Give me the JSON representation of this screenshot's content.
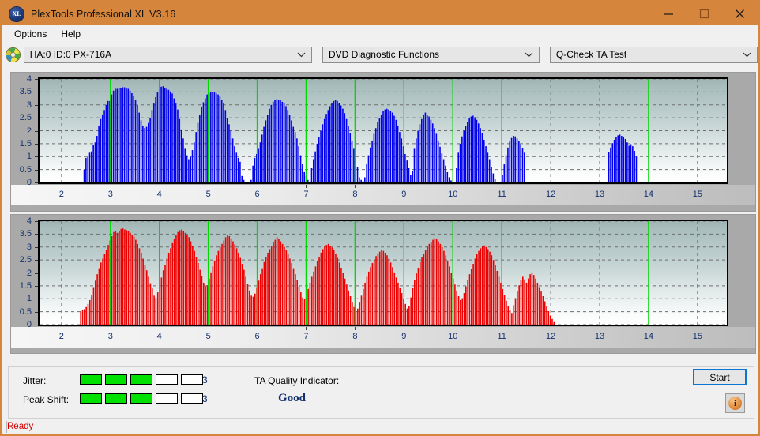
{
  "window": {
    "title": "PlexTools Professional XL V3.16",
    "icon": "XL",
    "minimize_label": "minimize-icon",
    "maximize_label": "maximize-icon",
    "close_label": "close-icon"
  },
  "menu": {
    "items": [
      {
        "label": "Options"
      },
      {
        "label": "Help"
      }
    ]
  },
  "selectors": {
    "drive": {
      "value": "HA:0 ID:0  PX-716A",
      "icon": "disc-icon"
    },
    "function": {
      "value": "DVD Diagnostic Functions"
    },
    "test": {
      "value": "Q-Check TA Test"
    }
  },
  "status": {
    "text": "Ready"
  },
  "results": {
    "jitter_label": "Jitter:",
    "jitter_value": "3",
    "jitter_filled": 3,
    "jitter_total": 5,
    "peak_shift_label": "Peak Shift:",
    "peak_shift_value": "3",
    "peak_shift_filled": 3,
    "peak_shift_total": 5,
    "tqi_label": "TA Quality Indicator:",
    "tqi_value": "Good",
    "start_label": "Start",
    "info_label": "i"
  },
  "colors": {
    "titlebar": "#d6863c",
    "jitter_series": "#0000ee",
    "peak_shift_series": "#ee0000",
    "marker_line": "#00d800",
    "axis_text": "#14306e",
    "status_text": "#d30000",
    "accent_focus": "#0b76d1"
  },
  "chart_data": [
    {
      "type": "bar",
      "title": "Jitter vs. Radius",
      "series_name": "Jitter",
      "color": "#0000ee",
      "xlabel": "",
      "ylabel": "",
      "xlim": [
        1.55,
        15.6
      ],
      "ylim": [
        0,
        4
      ],
      "xticks": [
        2,
        3,
        4,
        5,
        6,
        7,
        8,
        9,
        10,
        11,
        12,
        13,
        14,
        15
      ],
      "yticks": [
        0,
        0.5,
        1,
        1.5,
        2,
        2.5,
        3,
        3.5,
        4
      ],
      "grid": true,
      "marker_lines": [
        3,
        4,
        5,
        6,
        7,
        8,
        9,
        10,
        11,
        14
      ],
      "x_start": 2.45,
      "x_step": 0.0375,
      "values": [
        0.5,
        0.95,
        1.0,
        1.15,
        1.2,
        1.45,
        1.55,
        1.8,
        2.2,
        2.45,
        2.6,
        2.8,
        3.0,
        3.15,
        3.15,
        3.4,
        3.55,
        3.62,
        3.62,
        3.65,
        3.65,
        3.68,
        3.68,
        3.65,
        3.62,
        3.55,
        3.45,
        3.35,
        3.18,
        3.0,
        2.7,
        2.4,
        2.2,
        2.1,
        2.15,
        2.3,
        2.5,
        2.8,
        3.05,
        3.3,
        3.48,
        3.6,
        3.7,
        3.72,
        3.65,
        3.62,
        3.58,
        3.52,
        3.44,
        3.25,
        3.05,
        2.82,
        2.45,
        2.05,
        1.7,
        1.3,
        1.05,
        0.9,
        1.0,
        1.25,
        1.55,
        1.95,
        2.3,
        2.6,
        2.9,
        3.1,
        3.25,
        3.4,
        3.45,
        3.48,
        3.5,
        3.48,
        3.44,
        3.4,
        3.32,
        3.2,
        3.05,
        2.8,
        2.5,
        2.25,
        2.0,
        1.7,
        1.4,
        1.15,
        0.95,
        0.8,
        0.25,
        0.1,
        0.0,
        0.0,
        0.0,
        0.1,
        0.65,
        0.95,
        1.1,
        1.3,
        1.55,
        1.85,
        2.15,
        2.4,
        2.62,
        2.85,
        3.0,
        3.12,
        3.2,
        3.22,
        3.2,
        3.18,
        3.12,
        3.05,
        2.95,
        2.8,
        2.6,
        2.4,
        2.15,
        1.95,
        1.7,
        1.4,
        1.05,
        0.7,
        0.4,
        0.25,
        0.1,
        0.0,
        0.55,
        0.9,
        1.2,
        1.5,
        1.75,
        2.0,
        2.25,
        2.45,
        2.65,
        2.8,
        2.95,
        3.08,
        3.15,
        3.18,
        3.15,
        3.08,
        2.98,
        2.85,
        2.68,
        2.45,
        2.18,
        1.9,
        1.6,
        1.3,
        1.0,
        0.6,
        0.2,
        0.1,
        0.05,
        0.2,
        0.7,
        1.05,
        1.35,
        1.62,
        1.88,
        2.1,
        2.32,
        2.5,
        2.62,
        2.75,
        2.82,
        2.85,
        2.82,
        2.78,
        2.7,
        2.58,
        2.42,
        2.2,
        1.95,
        1.7,
        1.4,
        1.1,
        0.85,
        0.55,
        0.3,
        0.45,
        1.3,
        1.7,
        2.0,
        2.25,
        2.45,
        2.62,
        2.7,
        2.62,
        2.55,
        2.42,
        2.28,
        2.1,
        1.88,
        1.62,
        1.38,
        1.12,
        0.9,
        0.65,
        0.4,
        0.2,
        0.08,
        0.0,
        0.0,
        0.55,
        1.15,
        1.5,
        1.78,
        2.0,
        2.18,
        2.35,
        2.48,
        2.55,
        2.58,
        2.52,
        2.42,
        2.28,
        2.1,
        1.9,
        1.65,
        1.4,
        1.15,
        0.9,
        0.6,
        0.35,
        0.15,
        0.0,
        0.0,
        0.0,
        0.3,
        0.7,
        1.05,
        1.35,
        1.58,
        1.72,
        1.8,
        1.78,
        1.7,
        1.62,
        1.48,
        1.32,
        1.15,
        0.0,
        0.0,
        0.0,
        0.0,
        0.0,
        0.0,
        0.0,
        0.0,
        0.0,
        0.0,
        0.0,
        0.0,
        0.0,
        0.0,
        0.0,
        0.0,
        0.0,
        0.0,
        0.0,
        0.0,
        0.0,
        0.0,
        0.0,
        0.0,
        0.0,
        0.0,
        0.0,
        0.0,
        0.0,
        0.0,
        0.0,
        0.0,
        0.0,
        0.0,
        0.0,
        0.0,
        0.0,
        0.0,
        0.0,
        0.0,
        0.0,
        0.0,
        0.0,
        0.0,
        0.0,
        1.18,
        1.35,
        1.52,
        1.65,
        1.75,
        1.82,
        1.85,
        1.8,
        1.74,
        1.68,
        1.55,
        1.42,
        1.48,
        1.4,
        1.22,
        1.0,
        0.0,
        0.0,
        0.0,
        0.0,
        0.0,
        0.0,
        0.0,
        0.0,
        0.0,
        0.0,
        0.0,
        0.0,
        0.0,
        0.0,
        0.0,
        0.0,
        0.0,
        0.0
      ]
    },
    {
      "type": "bar",
      "title": "Peak Shift vs. Radius",
      "series_name": "Peak Shift",
      "color": "#ee0000",
      "xlabel": "",
      "ylabel": "",
      "xlim": [
        1.55,
        15.6
      ],
      "ylim": [
        0,
        4
      ],
      "xticks": [
        2,
        3,
        4,
        5,
        6,
        7,
        8,
        9,
        10,
        11,
        12,
        13,
        14,
        15
      ],
      "yticks": [
        0,
        0.5,
        1,
        1.5,
        2,
        2.5,
        3,
        3.5,
        4
      ],
      "grid": true,
      "marker_lines": [
        3,
        4,
        5,
        6,
        7,
        8,
        9,
        10,
        11,
        14
      ],
      "x_start": 2.38,
      "x_step": 0.0375,
      "values": [
        0.5,
        0.55,
        0.6,
        0.68,
        0.8,
        0.95,
        1.15,
        1.45,
        1.7,
        1.95,
        2.18,
        2.4,
        2.55,
        2.72,
        2.9,
        3.08,
        3.25,
        3.42,
        3.58,
        3.62,
        3.55,
        3.62,
        3.7,
        3.72,
        3.68,
        3.65,
        3.62,
        3.55,
        3.48,
        3.4,
        3.28,
        3.12,
        2.95,
        2.78,
        2.55,
        2.32,
        2.1,
        1.85,
        1.6,
        1.4,
        1.12,
        1.02,
        1.25,
        1.55,
        1.82,
        2.1,
        2.32,
        2.55,
        2.78,
        2.95,
        3.15,
        3.32,
        3.48,
        3.58,
        3.65,
        3.68,
        3.62,
        3.55,
        3.48,
        3.38,
        3.22,
        3.05,
        2.85,
        2.62,
        2.38,
        2.12,
        1.88,
        1.62,
        1.48,
        1.52,
        1.78,
        2.02,
        2.25,
        2.48,
        2.68,
        2.85,
        3.0,
        3.12,
        3.25,
        3.38,
        3.48,
        3.42,
        3.32,
        3.22,
        3.1,
        2.95,
        2.78,
        2.58,
        2.35,
        2.12,
        1.85,
        1.58,
        1.32,
        1.12,
        1.08,
        1.2,
        1.45,
        1.7,
        1.95,
        2.18,
        2.42,
        2.62,
        2.78,
        2.92,
        3.05,
        3.18,
        3.28,
        3.38,
        3.3,
        3.22,
        3.12,
        3.0,
        2.88,
        2.72,
        2.55,
        2.38,
        2.18,
        1.95,
        1.72,
        1.48,
        1.25,
        1.05,
        0.98,
        1.15,
        1.38,
        1.62,
        1.85,
        2.05,
        2.25,
        2.45,
        2.62,
        2.78,
        2.92,
        3.02,
        3.08,
        3.12,
        3.05,
        2.98,
        2.88,
        2.75,
        2.58,
        2.4,
        2.2,
        2.0,
        1.78,
        1.55,
        1.32,
        1.1,
        0.88,
        0.68,
        0.52,
        0.62,
        0.88,
        1.12,
        1.38,
        1.62,
        1.85,
        2.05,
        2.22,
        2.38,
        2.52,
        2.65,
        2.75,
        2.82,
        2.88,
        2.85,
        2.78,
        2.68,
        2.55,
        2.4,
        2.22,
        2.02,
        1.82,
        1.62,
        1.42,
        1.22,
        1.0,
        0.8,
        0.62,
        0.72,
        1.05,
        1.42,
        1.72,
        1.98,
        2.2,
        2.42,
        2.6,
        2.75,
        2.88,
        3.02,
        3.12,
        3.2,
        3.28,
        3.34,
        3.3,
        3.22,
        3.12,
        3.0,
        2.85,
        2.68,
        2.48,
        2.25,
        2.0,
        1.78,
        1.55,
        1.32,
        1.1,
        0.95,
        1.02,
        1.22,
        1.48,
        1.72,
        1.95,
        2.15,
        2.35,
        2.55,
        2.72,
        2.85,
        2.95,
        3.02,
        3.06,
        3.0,
        2.92,
        2.82,
        2.68,
        2.5,
        2.3,
        2.08,
        1.85,
        1.62,
        1.38,
        1.15,
        0.92,
        0.7,
        0.55,
        0.45,
        0.75,
        1.02,
        1.28,
        1.52,
        1.72,
        1.85,
        1.75,
        1.62,
        1.78,
        1.95,
        2.02,
        1.92,
        1.78,
        1.62,
        1.45,
        1.28,
        1.1,
        0.9,
        0.7,
        0.52,
        0.35,
        0.22,
        0.1,
        0.0,
        0.0,
        0.0,
        0.0,
        0.0,
        0.0,
        0.0,
        0.0,
        0.0,
        0.0,
        0.0,
        0.0,
        0.0,
        0.0,
        0.0,
        0.0,
        0.0,
        0.0,
        0.0,
        0.0,
        0.0,
        0.0,
        0.0,
        0.0,
        0.0,
        0.0,
        0.0,
        0.0,
        0.0,
        0.0,
        0.0,
        0.0,
        0.0,
        0.0,
        0.0,
        0.0,
        0.0,
        0.0,
        0.0,
        0.0,
        0.0,
        0.0,
        0.0,
        0.0,
        0.0,
        0.0,
        0.0,
        0.0,
        0.0,
        0.0,
        0.0,
        0.0,
        0.0,
        0.0,
        0.0,
        0.0,
        0.0,
        0.0,
        0.0,
        0.0,
        0.0
      ]
    }
  ]
}
